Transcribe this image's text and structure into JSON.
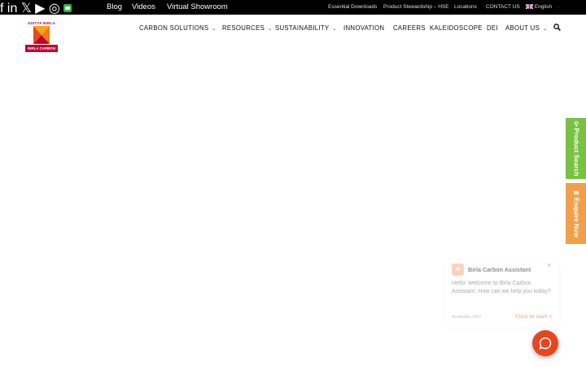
{
  "topbar": {
    "social": [
      "facebook-icon",
      "linkedin-icon",
      "x-icon",
      "youtube-icon",
      "instagram-icon",
      "wechat-icon"
    ],
    "links": [
      "Blog",
      "Videos",
      "Virtual Showroom"
    ],
    "utility": [
      "Essential Downloads",
      "Product Stewardship – HSE",
      "Locations",
      "CONTACT US"
    ],
    "language": "English"
  },
  "logo": {
    "brand": "ADITYA BIRLA",
    "sub": "BIRLA CARBON"
  },
  "nav": [
    "CARBON SOLUTIONS",
    "RESOURCES",
    "SUSTAINABILITY",
    "INNOVATION",
    "CAREERS",
    "KALEIDOSCOPE",
    "DEI",
    "ABOUT US"
  ],
  "side_tabs": {
    "product_search": "Product Search",
    "enquire_now": "Enquire Now"
  },
  "chat": {
    "title": "Birla Carbon Assistant",
    "message": "Hello! Welcome to Birla Carbon Assistant. How can we help you today?",
    "availability": "Available 24/7",
    "cta": "Click to start »"
  },
  "colors": {
    "accent_red": "#c3002f",
    "green_tab": "#79c143",
    "orange_tab": "#f0a04b",
    "chat_fab": "#e8451f"
  }
}
